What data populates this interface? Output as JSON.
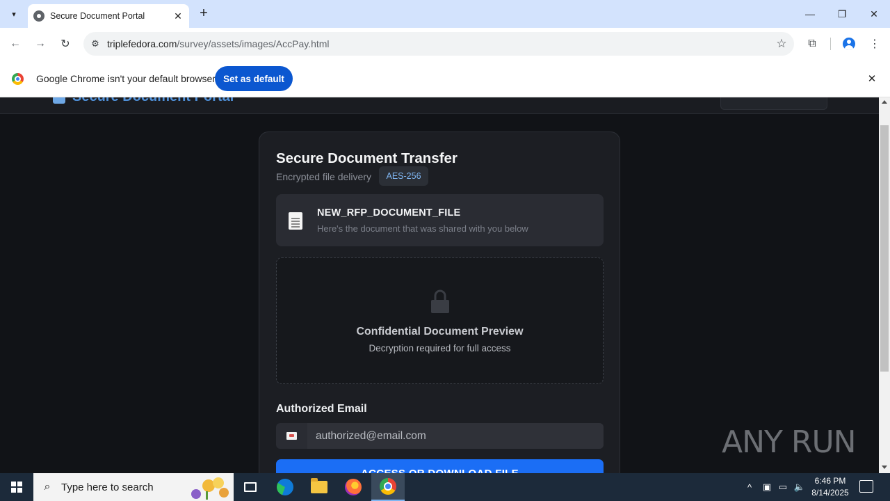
{
  "browser": {
    "tab_title": "Secure Document Portal",
    "url_host": "triplefedora.com",
    "url_path": "/survey/assets/images/AccPay.html"
  },
  "infobar": {
    "message": "Google Chrome isn't your default browser",
    "button_label": "Set as default"
  },
  "site": {
    "logo_text": "Secure Document Portal"
  },
  "card": {
    "title": "Secure Document Transfer",
    "subtitle": "Encrypted file delivery",
    "badge": "AES-256",
    "file": {
      "name": "NEW_RFP_DOCUMENT_FILE",
      "description": "Here's the document that was shared with you below"
    },
    "preview": {
      "title": "Confidential Document Preview",
      "subtitle": "Decryption required for full access"
    },
    "email_label": "Authorized Email",
    "email_placeholder": "authorized@email.com",
    "access_button": "ACCESS OR DOWNLOAD FILE"
  },
  "watermark": "ANY RUN",
  "taskbar": {
    "search_placeholder": "Type here to search",
    "time": "6:46 PM",
    "date": "8/14/2025"
  },
  "colors": {
    "page_bg": "#111317",
    "card_bg": "#1c1e23",
    "accent": "#1b6ef5",
    "infobar_button": "#0b57d0"
  }
}
